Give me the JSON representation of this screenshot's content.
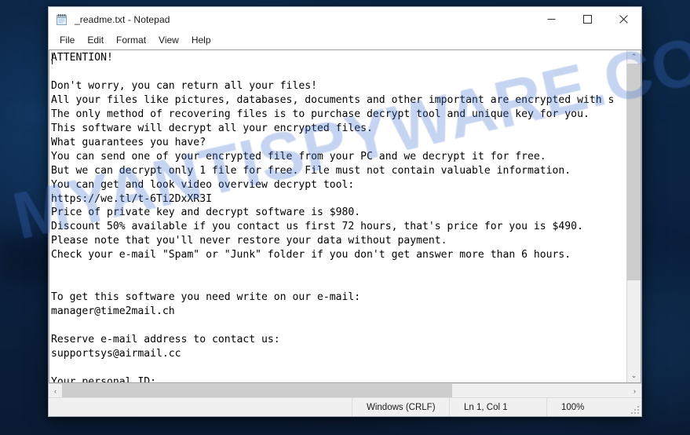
{
  "desktop": {
    "wallpaper_color": "#0b2242"
  },
  "watermark": {
    "text": "MYANTISPYWARE.COM",
    "color": "#4070cc"
  },
  "window": {
    "title": "_readme.txt - Notepad",
    "icon": "notepad-icon",
    "controls": {
      "minimize": "—",
      "maximize": "☐",
      "close": "✕"
    }
  },
  "menu": {
    "items": [
      {
        "label": "File"
      },
      {
        "label": "Edit"
      },
      {
        "label": "Format"
      },
      {
        "label": "View"
      },
      {
        "label": "Help"
      }
    ]
  },
  "editor": {
    "content": "ATTENTION!\n\nDon't worry, you can return all your files!\nAll your files like pictures, databases, documents and other important are encrypted with s\nThe only method of recovering files is to purchase decrypt tool and unique key for you.\nThis software will decrypt all your encrypted files.\nWhat guarantees you have?\nYou can send one of your encrypted file from your PC and we decrypt it for free.\nBut we can decrypt only 1 file for free. File must not contain valuable information.\nYou can get and look video overview decrypt tool:\nhttps://we.tl/t-6Ti2DxXR3I\nPrice of private key and decrypt software is $980.\nDiscount 50% available if you contact us first 72 hours, that's price for you is $490.\nPlease note that you'll never restore your data without payment.\nCheck your e-mail \"Spam\" or \"Junk\" folder if you don't get answer more than 6 hours.\n\n\nTo get this software you need write on our e-mail:\nmanager@time2mail.ch\n\nReserve e-mail address to contact us:\nsupportsys@airmail.cc\n\nYour personal ID:"
  },
  "scrollbars": {
    "vertical": {
      "up_arrow": "⌃",
      "down_arrow": "⌄"
    },
    "horizontal": {
      "left_arrow": "‹",
      "right_arrow": "›"
    }
  },
  "status_bar": {
    "line_ending": "Windows (CRLF)",
    "cursor_position": "Ln 1, Col 1",
    "zoom": "100%"
  }
}
